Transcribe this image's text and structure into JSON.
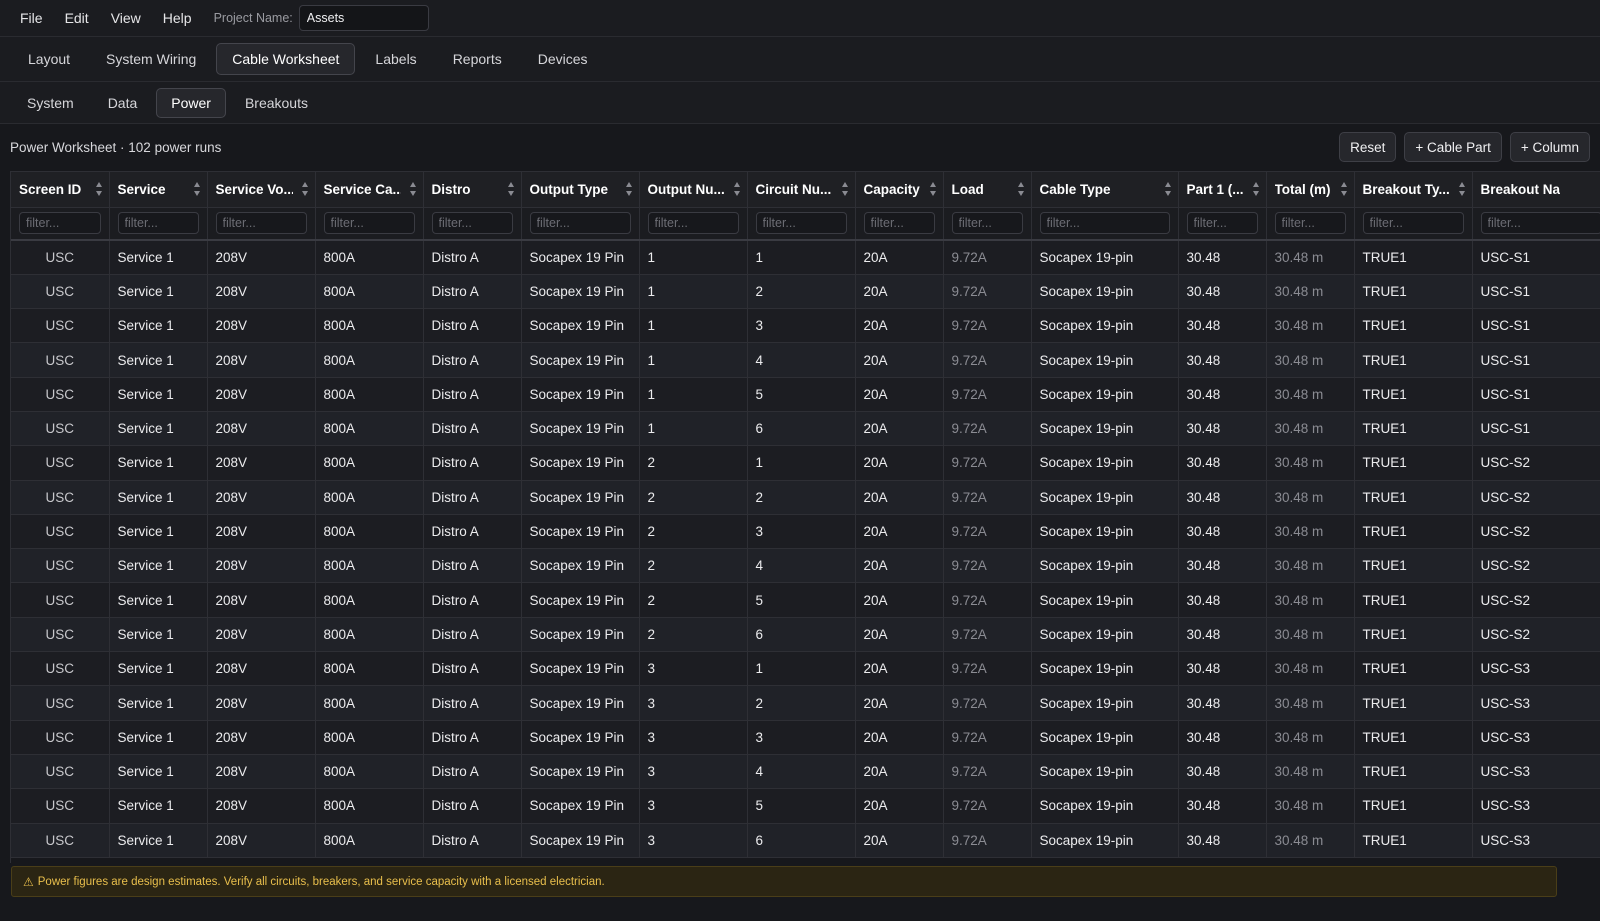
{
  "menubar": {
    "items": [
      "File",
      "Edit",
      "View",
      "Help"
    ],
    "project_label": "Project Name:",
    "project_value": "Assets"
  },
  "tabs": [
    "Layout",
    "System Wiring",
    "Cable Worksheet",
    "Labels",
    "Reports",
    "Devices"
  ],
  "active_tab": "Cable Worksheet",
  "subtabs": [
    "System",
    "Data",
    "Power",
    "Breakouts"
  ],
  "active_subtab": "Power",
  "toolbar": {
    "title": "Power Worksheet · 102 power runs",
    "reset_label": "Reset",
    "cable_part_label": "+ Cable Part",
    "column_label": "+ Column"
  },
  "table": {
    "columns": [
      {
        "label": "Screen ID",
        "sortable": true
      },
      {
        "label": "Service",
        "sortable": true
      },
      {
        "label": "Service Vo...",
        "sortable": true
      },
      {
        "label": "Service Ca...",
        "sortable": true
      },
      {
        "label": "Distro",
        "sortable": true
      },
      {
        "label": "Output Type",
        "sortable": true
      },
      {
        "label": "Output Nu...",
        "sortable": true
      },
      {
        "label": "Circuit Nu...",
        "sortable": true
      },
      {
        "label": "Capacity",
        "sortable": true
      },
      {
        "label": "Load",
        "sortable": true
      },
      {
        "label": "Cable Type",
        "sortable": true
      },
      {
        "label": "Part 1 (...",
        "sortable": true
      },
      {
        "label": "Total (m)",
        "sortable": true
      },
      {
        "label": "Breakout Ty...",
        "sortable": true
      },
      {
        "label": "Breakout Na",
        "sortable": false
      }
    ],
    "filter_placeholder": "filter...",
    "rows": [
      [
        "USC",
        "Service 1",
        "208V",
        "800A",
        "Distro A",
        "Socapex 19 Pin",
        "1",
        "1",
        "20A",
        "9.72A",
        "Socapex 19-pin",
        "30.48",
        "30.48 m",
        "TRUE1",
        "USC-S1"
      ],
      [
        "USC",
        "Service 1",
        "208V",
        "800A",
        "Distro A",
        "Socapex 19 Pin",
        "1",
        "2",
        "20A",
        "9.72A",
        "Socapex 19-pin",
        "30.48",
        "30.48 m",
        "TRUE1",
        "USC-S1"
      ],
      [
        "USC",
        "Service 1",
        "208V",
        "800A",
        "Distro A",
        "Socapex 19 Pin",
        "1",
        "3",
        "20A",
        "9.72A",
        "Socapex 19-pin",
        "30.48",
        "30.48 m",
        "TRUE1",
        "USC-S1"
      ],
      [
        "USC",
        "Service 1",
        "208V",
        "800A",
        "Distro A",
        "Socapex 19 Pin",
        "1",
        "4",
        "20A",
        "9.72A",
        "Socapex 19-pin",
        "30.48",
        "30.48 m",
        "TRUE1",
        "USC-S1"
      ],
      [
        "USC",
        "Service 1",
        "208V",
        "800A",
        "Distro A",
        "Socapex 19 Pin",
        "1",
        "5",
        "20A",
        "9.72A",
        "Socapex 19-pin",
        "30.48",
        "30.48 m",
        "TRUE1",
        "USC-S1"
      ],
      [
        "USC",
        "Service 1",
        "208V",
        "800A",
        "Distro A",
        "Socapex 19 Pin",
        "1",
        "6",
        "20A",
        "9.72A",
        "Socapex 19-pin",
        "30.48",
        "30.48 m",
        "TRUE1",
        "USC-S1"
      ],
      [
        "USC",
        "Service 1",
        "208V",
        "800A",
        "Distro A",
        "Socapex 19 Pin",
        "2",
        "1",
        "20A",
        "9.72A",
        "Socapex 19-pin",
        "30.48",
        "30.48 m",
        "TRUE1",
        "USC-S2"
      ],
      [
        "USC",
        "Service 1",
        "208V",
        "800A",
        "Distro A",
        "Socapex 19 Pin",
        "2",
        "2",
        "20A",
        "9.72A",
        "Socapex 19-pin",
        "30.48",
        "30.48 m",
        "TRUE1",
        "USC-S2"
      ],
      [
        "USC",
        "Service 1",
        "208V",
        "800A",
        "Distro A",
        "Socapex 19 Pin",
        "2",
        "3",
        "20A",
        "9.72A",
        "Socapex 19-pin",
        "30.48",
        "30.48 m",
        "TRUE1",
        "USC-S2"
      ],
      [
        "USC",
        "Service 1",
        "208V",
        "800A",
        "Distro A",
        "Socapex 19 Pin",
        "2",
        "4",
        "20A",
        "9.72A",
        "Socapex 19-pin",
        "30.48",
        "30.48 m",
        "TRUE1",
        "USC-S2"
      ],
      [
        "USC",
        "Service 1",
        "208V",
        "800A",
        "Distro A",
        "Socapex 19 Pin",
        "2",
        "5",
        "20A",
        "9.72A",
        "Socapex 19-pin",
        "30.48",
        "30.48 m",
        "TRUE1",
        "USC-S2"
      ],
      [
        "USC",
        "Service 1",
        "208V",
        "800A",
        "Distro A",
        "Socapex 19 Pin",
        "2",
        "6",
        "20A",
        "9.72A",
        "Socapex 19-pin",
        "30.48",
        "30.48 m",
        "TRUE1",
        "USC-S2"
      ],
      [
        "USC",
        "Service 1",
        "208V",
        "800A",
        "Distro A",
        "Socapex 19 Pin",
        "3",
        "1",
        "20A",
        "9.72A",
        "Socapex 19-pin",
        "30.48",
        "30.48 m",
        "TRUE1",
        "USC-S3"
      ],
      [
        "USC",
        "Service 1",
        "208V",
        "800A",
        "Distro A",
        "Socapex 19 Pin",
        "3",
        "2",
        "20A",
        "9.72A",
        "Socapex 19-pin",
        "30.48",
        "30.48 m",
        "TRUE1",
        "USC-S3"
      ],
      [
        "USC",
        "Service 1",
        "208V",
        "800A",
        "Distro A",
        "Socapex 19 Pin",
        "3",
        "3",
        "20A",
        "9.72A",
        "Socapex 19-pin",
        "30.48",
        "30.48 m",
        "TRUE1",
        "USC-S3"
      ],
      [
        "USC",
        "Service 1",
        "208V",
        "800A",
        "Distro A",
        "Socapex 19 Pin",
        "3",
        "4",
        "20A",
        "9.72A",
        "Socapex 19-pin",
        "30.48",
        "30.48 m",
        "TRUE1",
        "USC-S3"
      ],
      [
        "USC",
        "Service 1",
        "208V",
        "800A",
        "Distro A",
        "Socapex 19 Pin",
        "3",
        "5",
        "20A",
        "9.72A",
        "Socapex 19-pin",
        "30.48",
        "30.48 m",
        "TRUE1",
        "USC-S3"
      ],
      [
        "USC",
        "Service 1",
        "208V",
        "800A",
        "Distro A",
        "Socapex 19 Pin",
        "3",
        "6",
        "20A",
        "9.72A",
        "Socapex 19-pin",
        "30.48",
        "30.48 m",
        "TRUE1",
        "USC-S3"
      ]
    ]
  },
  "notice": {
    "icon": "warning-icon",
    "text": "Power figures are design estimates. Verify all circuits, breakers, and service capacity with a licensed electrician."
  },
  "colors": {
    "background": "#17181c",
    "notice_text": "#e9bf4c",
    "notice_background": "#2b2513"
  }
}
